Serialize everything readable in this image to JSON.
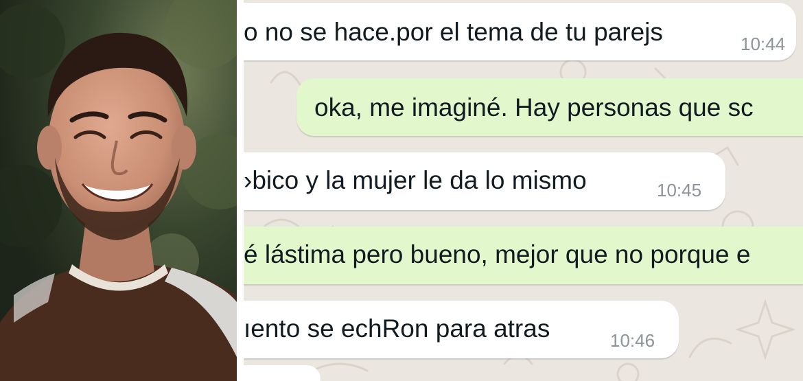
{
  "photo": {
    "subject": "smiling-man-portrait"
  },
  "chat": {
    "background_color": "#ebe6df",
    "incoming_color": "#ffffff",
    "outgoing_color": "#e2f7cb",
    "messages": [
      {
        "direction": "in",
        "text": "o no se hace.por el tema de tu parejs",
        "time": "10:44"
      },
      {
        "direction": "out",
        "text": "oka, me imaginé. Hay personas que sc",
        "time": ""
      },
      {
        "direction": "in",
        "text": "›bico y la mujer le da lo mismo",
        "time": "10:45"
      },
      {
        "direction": "out",
        "text": "é lástima pero bueno, mejor que no porque e",
        "time": ""
      },
      {
        "direction": "in",
        "text": "ıento se echRon para atras",
        "time": "10:46"
      },
      {
        "direction": "in",
        "text": "",
        "time": ""
      }
    ]
  }
}
